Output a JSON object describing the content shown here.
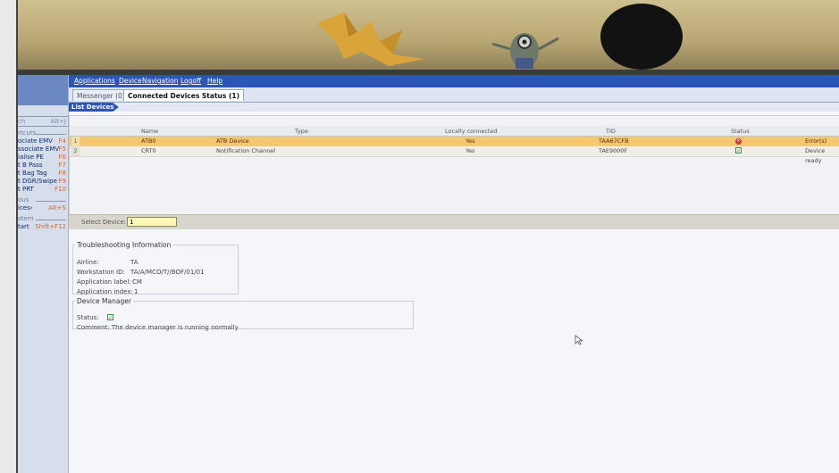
{
  "menu": [
    "Applications",
    "Device",
    "Navigation",
    "Logoff",
    "Help"
  ],
  "tabs": [
    {
      "label": "Messenger (0)",
      "active": false
    },
    {
      "label": "Connected Devices Status (1)",
      "active": true
    }
  ],
  "section_title": "List Devices",
  "sidebar": {
    "search": {
      "label": "ch",
      "key": "Alt+J"
    },
    "items": [
      {
        "label": "rtcuts",
        "key": "",
        "section": true
      },
      {
        "label": "ociate EMV",
        "key": "F4"
      },
      {
        "label": "ssociate EMV",
        "key": "F5"
      },
      {
        "label": "ialise PE",
        "key": "F6"
      },
      {
        "label": "t B Pass",
        "key": "F7"
      },
      {
        "label": "t Bag Tag",
        "key": "F8"
      },
      {
        "label": "t DGR/Swipe",
        "key": "F9"
      },
      {
        "label": "t PRT",
        "key": "F10"
      },
      {
        "label": "ous",
        "key": "",
        "section": true
      },
      {
        "label": "ices›",
        "key": "Alt+S"
      },
      {
        "label": "stem",
        "key": "",
        "section": true
      },
      {
        "label": "tart",
        "key": "Shift+F12"
      }
    ]
  },
  "device_table": {
    "columns": [
      "Name",
      "Type",
      "Locally connected",
      "TID",
      "Status"
    ],
    "rows": [
      {
        "num": "1",
        "name": "ATB0",
        "type": "ATB Device",
        "local": "Yes",
        "tid": "TAA67CFB",
        "status": "error",
        "message": "Error(s) dete",
        "selected": true
      },
      {
        "num": "2",
        "name": "CRT0",
        "type": "Notification Channel",
        "local": "Yes",
        "tid": "TAE9000F",
        "status": "ok",
        "message": "Device ready",
        "selected": false
      }
    ]
  },
  "select_device": {
    "label": "Select Device:",
    "value": "1"
  },
  "troubleshooting": {
    "title": "Troubleshooting Information",
    "fields": [
      {
        "label": "Airline:",
        "value": "TA"
      },
      {
        "label": "Workstation ID:",
        "value": "TA/A/MCO/T//BOF/01/01"
      },
      {
        "label": "Application label:",
        "value": "CM"
      },
      {
        "label": "Application index:",
        "value": "1"
      }
    ]
  },
  "device_manager": {
    "title": "Device Manager",
    "status_label": "Status:",
    "comment_label": "Comment:",
    "comment": "The device manager is running normally"
  },
  "colors": {
    "menubar": "#2b56b7",
    "selected_row": "#f7c86a",
    "error": "#d23a32",
    "ok": "#3c8e3a"
  }
}
